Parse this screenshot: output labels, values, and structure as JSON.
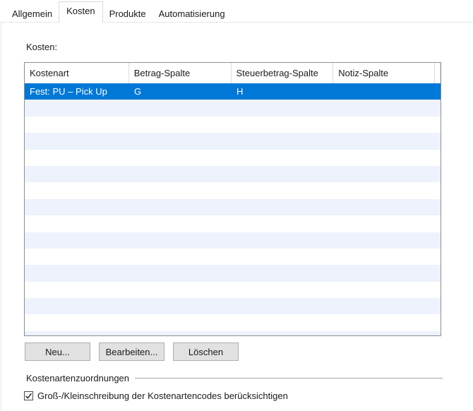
{
  "tabs": {
    "items": [
      {
        "label": "Allgemein",
        "selected": false
      },
      {
        "label": "Kosten",
        "selected": true
      },
      {
        "label": "Produkte",
        "selected": false
      },
      {
        "label": "Automatisierung",
        "selected": false
      }
    ]
  },
  "section": {
    "label": "Kosten:"
  },
  "table": {
    "columns": [
      {
        "label": "Kostenart",
        "width": 148
      },
      {
        "label": "Betrag-Spalte",
        "width": 145
      },
      {
        "label": "Steuerbetrag-Spalte",
        "width": 145
      },
      {
        "label": "Notiz-Spalte",
        "width": 144
      }
    ],
    "rows": [
      {
        "cells": [
          "Fest: PU – Pick Up",
          "G",
          "H",
          ""
        ],
        "selected": true
      }
    ],
    "empty_row_count": 15
  },
  "action_buttons": [
    {
      "label": "Neu...",
      "name": "neu-button"
    },
    {
      "label": "Bearbeiten...",
      "name": "bearbeiten-button"
    },
    {
      "label": "Löschen",
      "name": "loeschen-button"
    }
  ],
  "group": {
    "label": "Kostenartenzuordnungen"
  },
  "checkbox": {
    "label": "Groß-/Kleinschreibung der Kostenartencodes berücksichtigen",
    "checked": true
  },
  "colors": {
    "selection_bg": "#0078d7",
    "selection_text": "#ffffff",
    "alt_row_bg": "#edf2fc",
    "table_border": "#8b8e92",
    "header_separator": "#dcdcdc",
    "tab_border": "#d9d9d9",
    "strip_line": "#e6e6e6",
    "button_bg": "#e1e1e1",
    "button_border": "#adadad",
    "group_line": "#a6a6a6",
    "text": "#1a1a1a"
  }
}
